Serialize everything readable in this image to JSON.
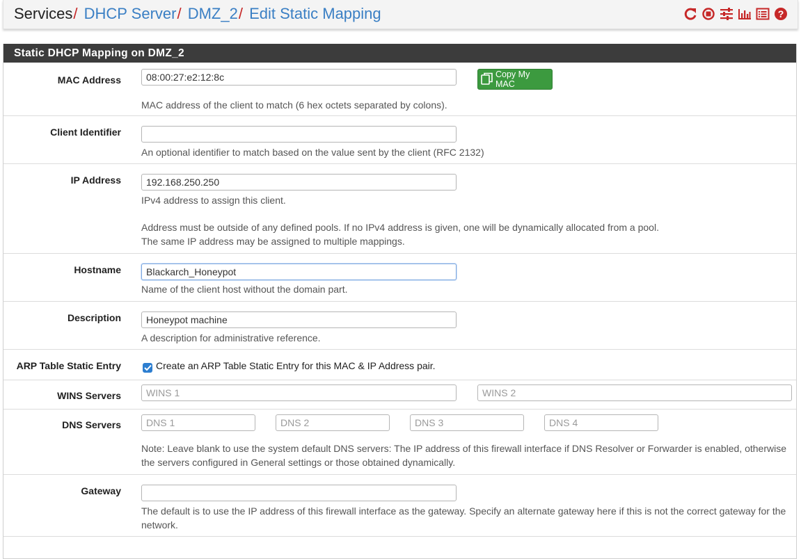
{
  "breadcrumb": {
    "items": [
      {
        "label": "Services",
        "link": false
      },
      {
        "label": "DHCP Server",
        "link": true
      },
      {
        "label": "DMZ_2",
        "link": true
      },
      {
        "label": "Edit Static Mapping",
        "link": true
      }
    ],
    "separator": "/"
  },
  "header_icons": [
    "reload-icon",
    "stop-icon",
    "sliders-icon",
    "bar-chart-icon",
    "list-icon",
    "help-icon"
  ],
  "colors": {
    "accent_red": "#c62828",
    "link_blue": "#3a7fc4",
    "panel_header": "#3c3c3c",
    "button_green": "#3c9a3f",
    "checkbox_blue": "#2d7ed0"
  },
  "panel": {
    "title": "Static DHCP Mapping on DMZ_2"
  },
  "fields": {
    "mac": {
      "label": "MAC Address",
      "value": "08:00:27:e2:12:8c",
      "button_label": "Copy My MAC",
      "help": "MAC address of the client to match (6 hex octets separated by colons)."
    },
    "client_id": {
      "label": "Client Identifier",
      "value": "",
      "help": "An optional identifier to match based on the value sent by the client (RFC 2132)"
    },
    "ip": {
      "label": "IP Address",
      "value": "192.168.250.250",
      "help1": "IPv4 address to assign this client.",
      "help2": "Address must be outside of any defined pools. If no IPv4 address is given, one will be dynamically allocated from a pool.",
      "help3": "The same IP address may be assigned to multiple mappings."
    },
    "hostname": {
      "label": "Hostname",
      "value": "Blackarch_Honeypot",
      "help": "Name of the client host without the domain part."
    },
    "description": {
      "label": "Description",
      "value": "Honeypot machine",
      "help": "A description for administrative reference."
    },
    "arp": {
      "label": "ARP Table Static Entry",
      "checked": true,
      "checkbox_label": "Create an ARP Table Static Entry for this MAC & IP Address pair."
    },
    "wins": {
      "label": "WINS Servers",
      "placeholders": [
        "WINS 1",
        "WINS 2"
      ]
    },
    "dns": {
      "label": "DNS Servers",
      "placeholders": [
        "DNS 1",
        "DNS 2",
        "DNS 3",
        "DNS 4"
      ],
      "help1": "Note: Leave blank to use the system default DNS servers: The IP address of this firewall interface if DNS Resolver or Forwarder is enabled, otherwise",
      "help2": "the servers configured in General settings or those obtained dynamically."
    },
    "gateway": {
      "label": "Gateway",
      "value": "",
      "help1": "The default is to use the IP address of this firewall interface as the gateway. Specify an alternate gateway here if this is not the correct gateway for the",
      "help2": "network."
    }
  }
}
